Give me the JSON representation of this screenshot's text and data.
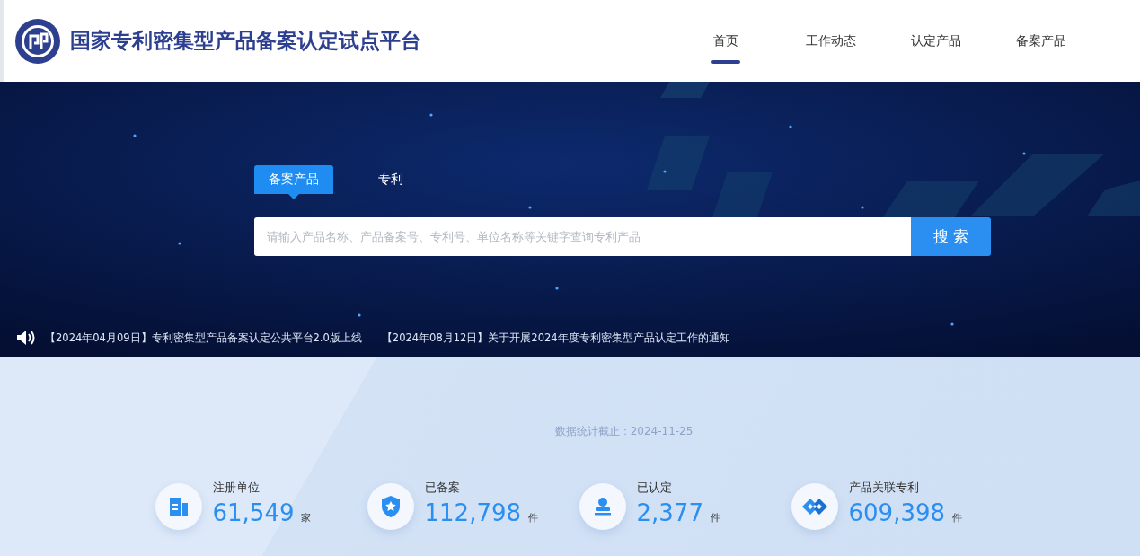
{
  "header": {
    "title": "国家专利密集型产品备案认定试点平台",
    "nav": [
      {
        "label": "首页",
        "selected": true
      },
      {
        "label": "工作动态",
        "selected": false
      },
      {
        "label": "认定产品",
        "selected": false
      },
      {
        "label": "备案产品",
        "selected": false
      }
    ]
  },
  "search": {
    "tabs": [
      {
        "label": "备案产品",
        "selected": true
      },
      {
        "label": "专利",
        "selected": false
      }
    ],
    "placeholder": "请输入产品名称、产品备案号、专利号、单位名称等关键字查询专利产品",
    "button": "搜 索"
  },
  "notices": [
    "【2024年04月09日】专利密集型产品备案认定公共平台2.0版上线",
    "【2024年08月12日】关于开展2024年度专利密集型产品认定工作的通知"
  ],
  "stats": {
    "date": "数据统计截止：2024-11-25",
    "items": [
      {
        "kind": "building",
        "label": "注册单位",
        "value": "61,549",
        "unit": "家"
      },
      {
        "kind": "shield",
        "label": "已备案",
        "value": "112,798",
        "unit": "件"
      },
      {
        "kind": "stamp",
        "label": "已认定",
        "value": "2,377",
        "unit": "件"
      },
      {
        "kind": "link",
        "label": "产品关联专利",
        "value": "609,398",
        "unit": "件"
      }
    ]
  }
}
